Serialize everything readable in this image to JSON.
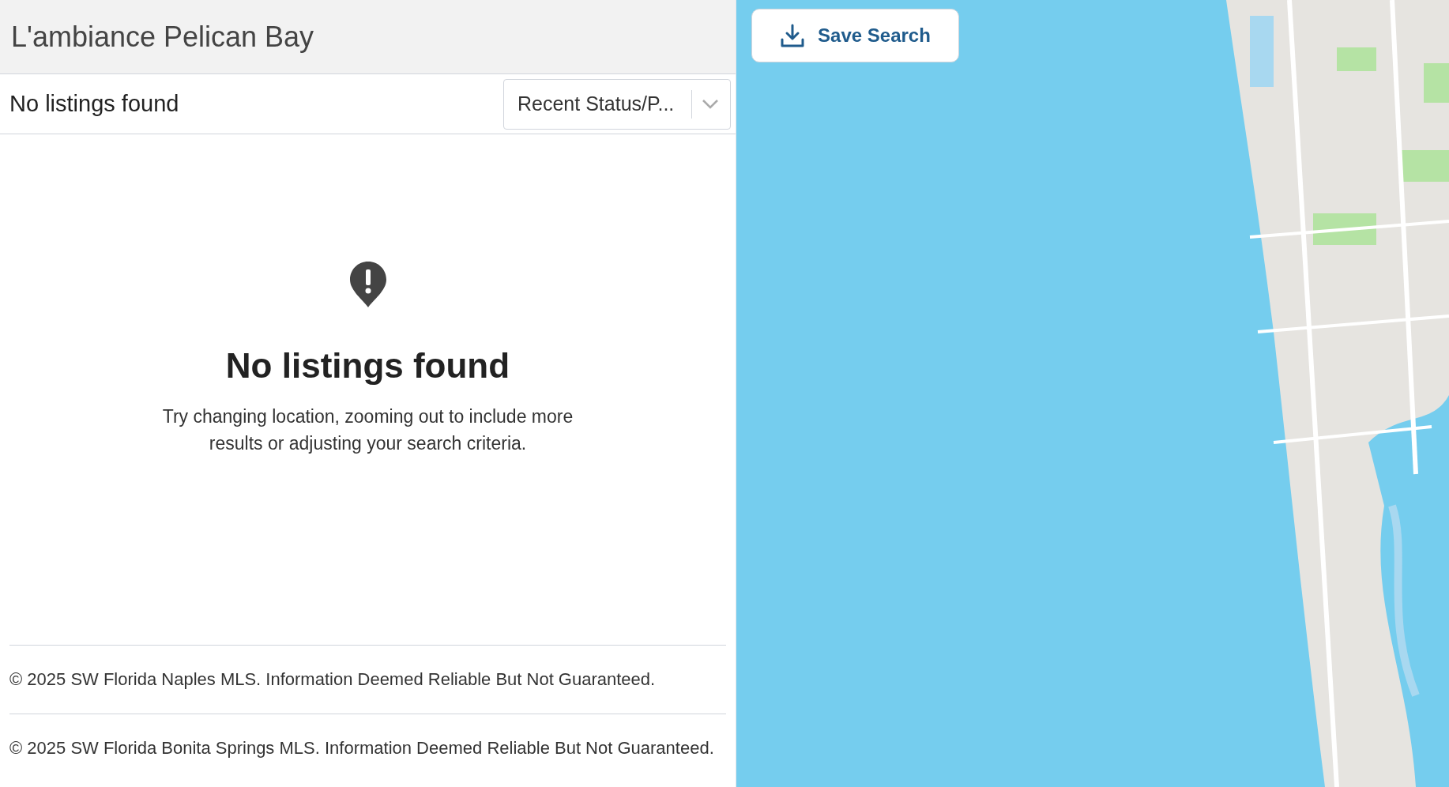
{
  "header": {
    "title": "L'ambiance Pelican Bay"
  },
  "toolbar": {
    "result_count": "No listings found",
    "sort": {
      "value": "Recent Status/P..."
    }
  },
  "empty_state": {
    "title": "No listings found",
    "message": "Try changing location, zooming out to include more results or adjusting your search criteria."
  },
  "disclaimers": [
    "© 2025 SW Florida Naples MLS. Information Deemed Reliable But Not Guaranteed.",
    "© 2025 SW Florida Bonita Springs MLS. Information Deemed Reliable But Not Guaranteed."
  ],
  "map": {
    "kind": "picture",
    "save_button": "Save Search"
  }
}
